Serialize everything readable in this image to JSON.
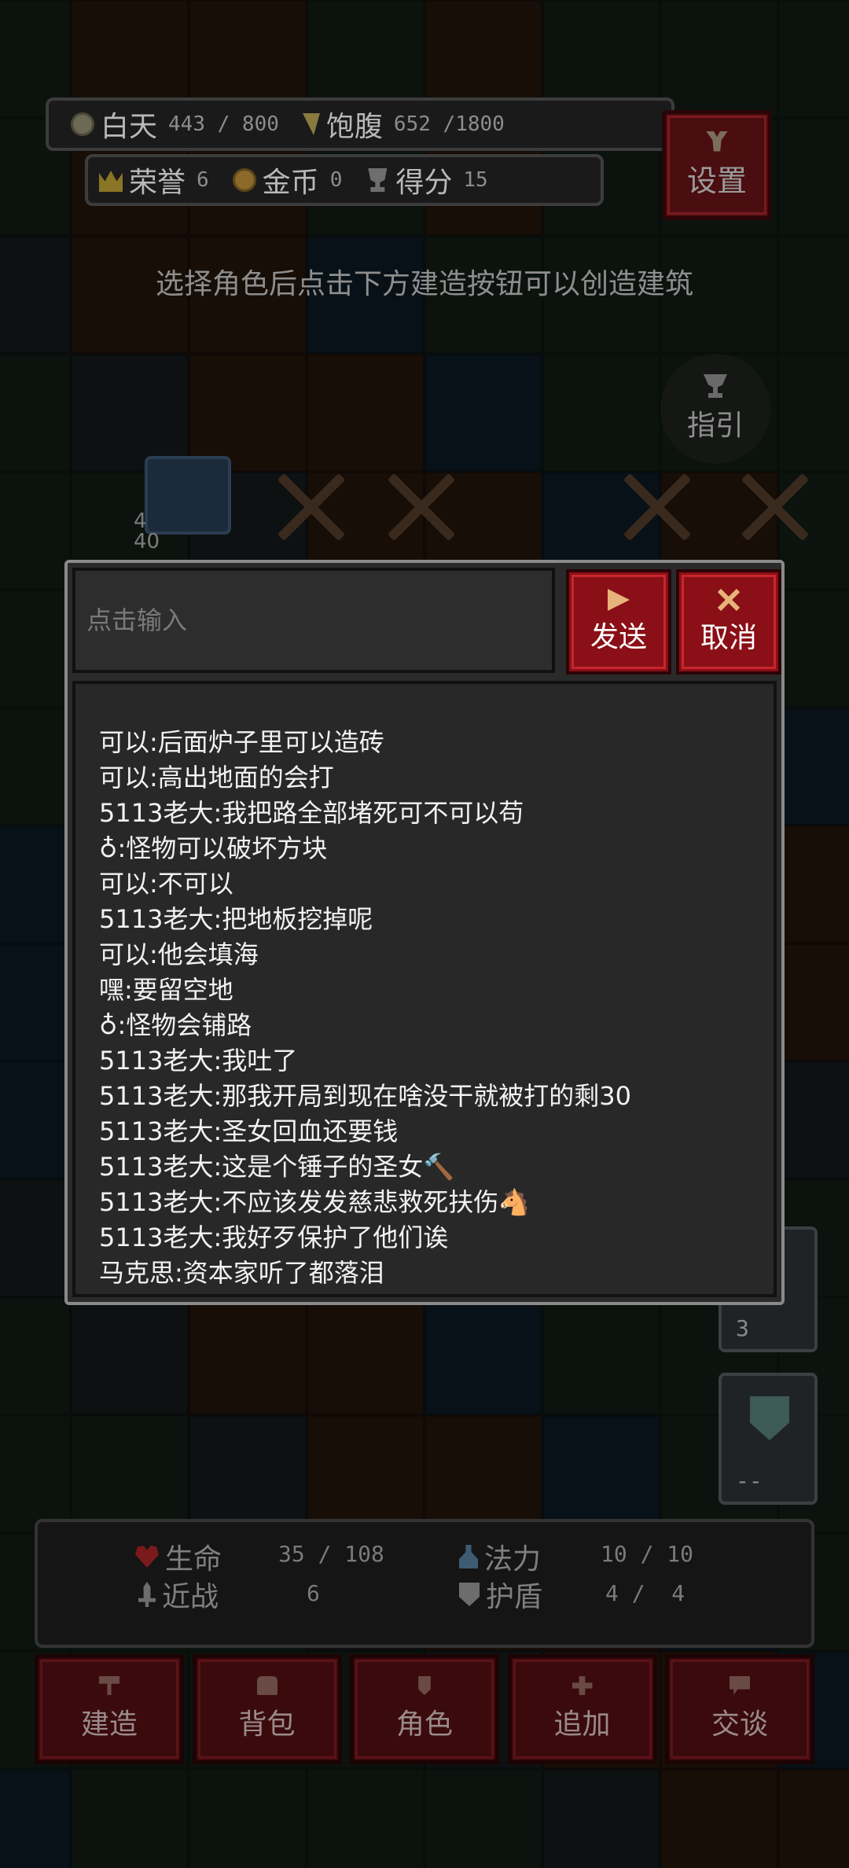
{
  "hud": {
    "day": {
      "label": "白天",
      "value": "443 / 800"
    },
    "satiety": {
      "label": "饱腹",
      "value": "652 /1800"
    },
    "honor": {
      "label": "荣誉",
      "value": "6"
    },
    "gold": {
      "label": "金币",
      "value": "0"
    },
    "score": {
      "label": "得分",
      "value": "15"
    },
    "settings_label": "设置"
  },
  "hint_text": "选择角色后点击下方建造按钮可以创造建筑",
  "guide_label": "指引",
  "unit": {
    "hp_a": "4",
    "hp_b": "40"
  },
  "chat": {
    "input_placeholder": "点击输入",
    "send_label": "发送",
    "cancel_label": "取消",
    "messages": [
      "可以:后面炉子里可以造砖",
      "可以:高出地面的会打",
      "5113老大:我把路全部堵死可不可以苟",
      "♁:怪物可以破坏方块",
      "可以:不可以",
      "5113老大:把地板挖掉呢",
      "可以:他会填海",
      "嘿:要留空地",
      "♁:怪物会铺路",
      "5113老大:我吐了",
      "5113老大:那我开局到现在啥没干就被打的剩30",
      "5113老大:圣女回血还要钱",
      "5113老大:这是个锤子的圣女🔨",
      "5113老大:不应该发发慈悲救死扶伤🐴",
      "5113老大:我好歹保护了他们诶",
      "马克思:资本家听了都落泪"
    ]
  },
  "side_slots": {
    "potion_count": "3",
    "shield_count": "--"
  },
  "player_stats": {
    "life": {
      "label": "生命",
      "value": "35 / 108"
    },
    "mana": {
      "label": "法力",
      "value": "10 / 10"
    },
    "melee": {
      "label": "近战",
      "value": "6"
    },
    "shield": {
      "label": "护盾",
      "value": "4 /  4"
    }
  },
  "nav": [
    "建造",
    "背包",
    "角色",
    "追加",
    "交谈"
  ]
}
